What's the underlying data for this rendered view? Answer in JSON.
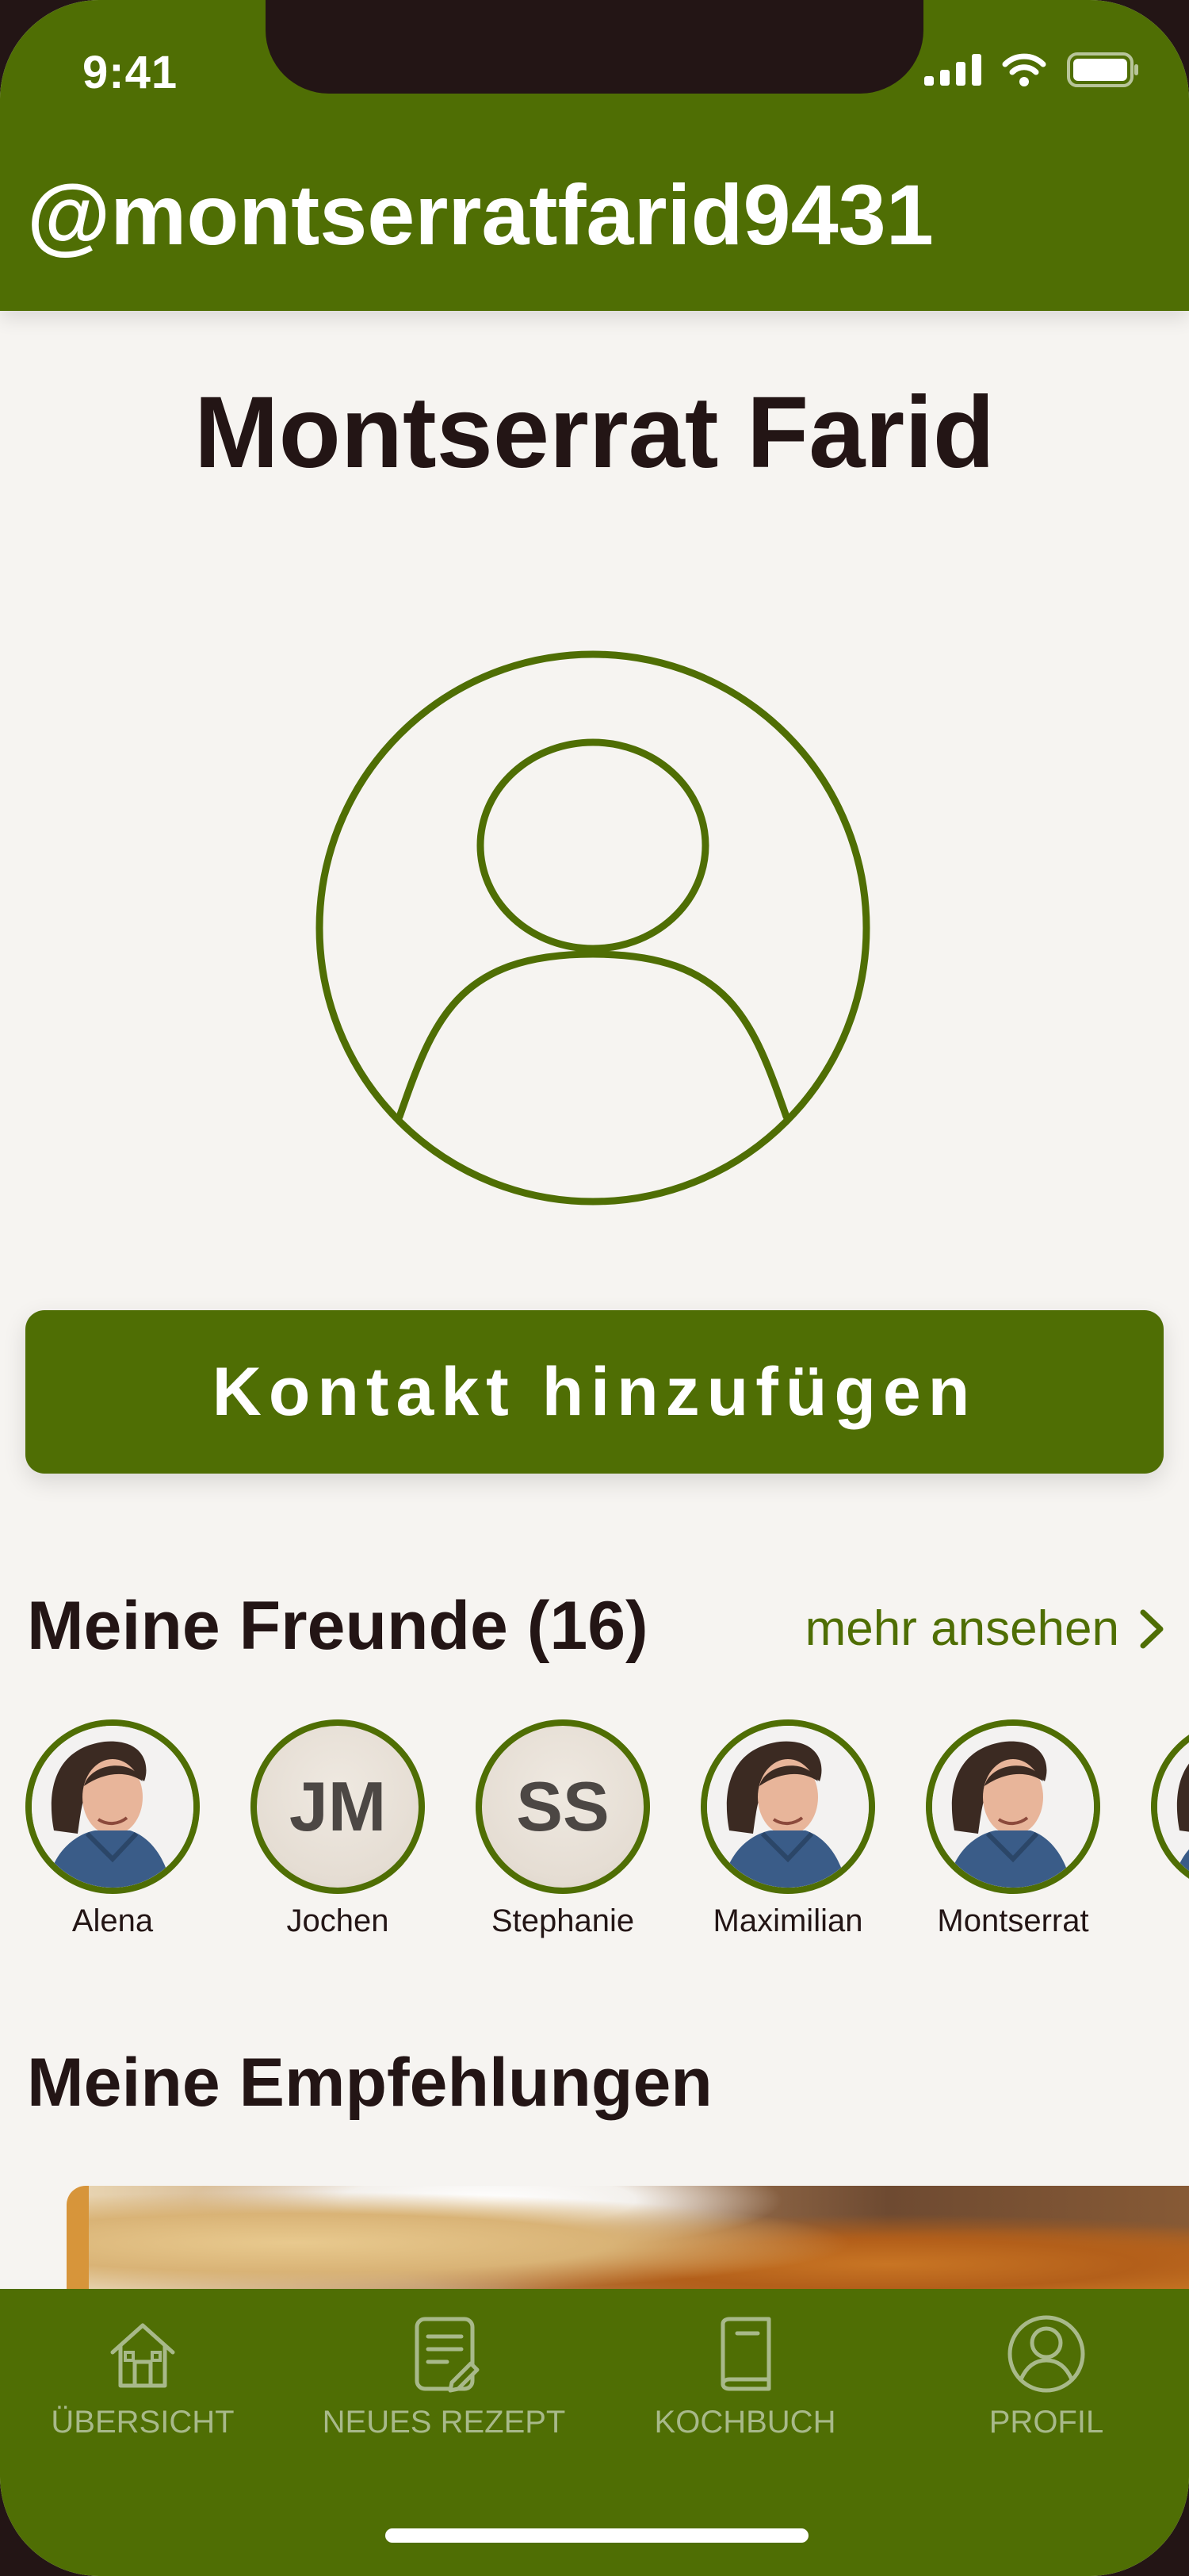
{
  "status_bar": {
    "time": "9:41",
    "icons": [
      "cellular-signal-icon",
      "wifi-icon",
      "battery-icon"
    ]
  },
  "header": {
    "username": "@montserratfarid9431"
  },
  "profile": {
    "name": "Montserrat Farid",
    "avatar_icon": "user-circle-icon",
    "add_contact_label": "Kontakt hinzufügen"
  },
  "friends": {
    "title": "Meine Freunde (16)",
    "see_more_label": "mehr ansehen",
    "items": [
      {
        "name": "Alena",
        "type": "photo"
      },
      {
        "name": "Jochen",
        "type": "initials",
        "initials": "JM"
      },
      {
        "name": "Stephanie",
        "type": "initials",
        "initials": "SS"
      },
      {
        "name": "Maximilian",
        "type": "photo"
      },
      {
        "name": "Montserrat",
        "type": "photo"
      }
    ]
  },
  "recommendations": {
    "title": "Meine Empfehlungen"
  },
  "tabbar": {
    "items": [
      {
        "label": "ÜBERSICHT",
        "icon": "home-icon"
      },
      {
        "label": "NEUES REZEPT",
        "icon": "new-recipe-icon"
      },
      {
        "label": "KOCHBUCH",
        "icon": "cookbook-icon"
      },
      {
        "label": "PROFIL",
        "icon": "profile-icon"
      }
    ]
  },
  "colors": {
    "brand_green": "#4f6e04",
    "background": "#f6f4f1",
    "text_dark": "#231515",
    "tab_inactive": "#a8b98a",
    "accent_orange": "#d7953a"
  }
}
